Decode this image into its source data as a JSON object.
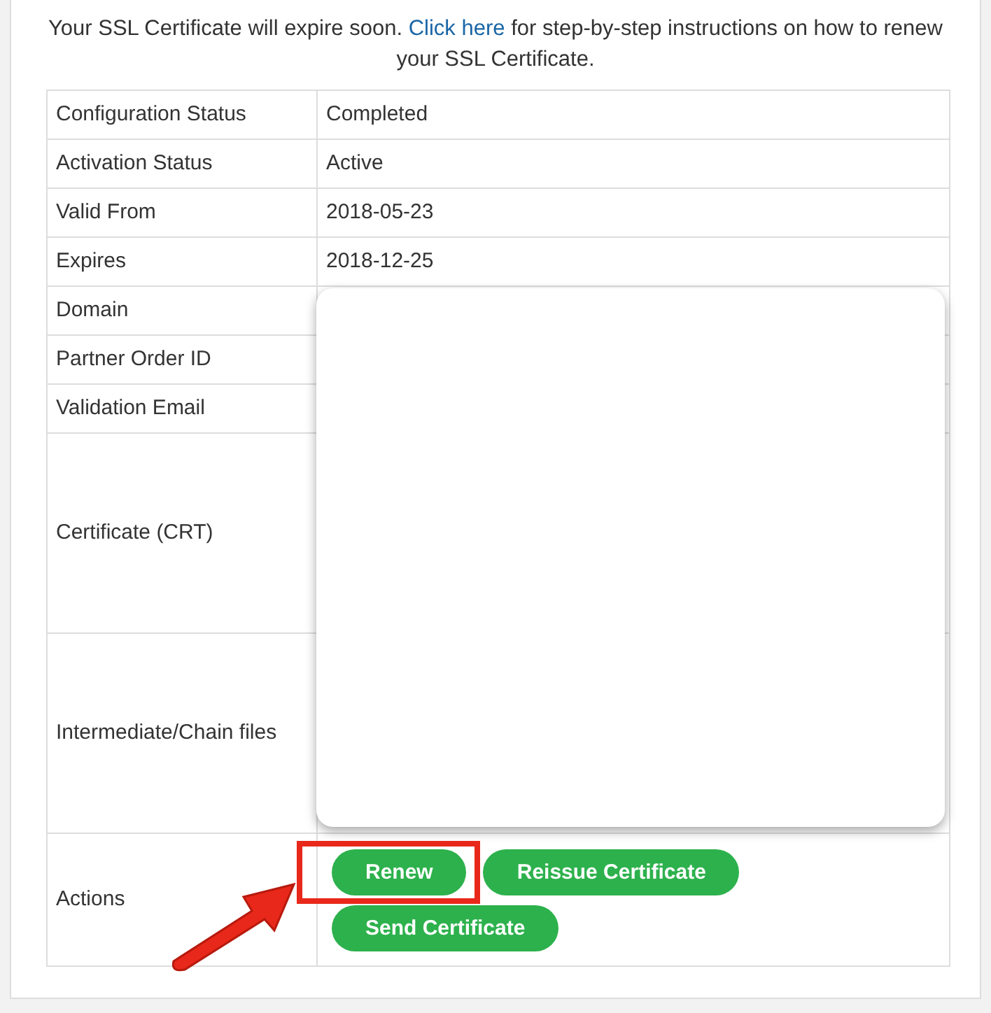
{
  "notice": {
    "text": "Your SSL Certificate will expire soon.",
    "link": "Click here",
    "after": "for step-by-step instructions on how to renew your SSL Certificate."
  },
  "details": [
    {
      "label": "Configuration Status",
      "value": "Completed",
      "kind": "normal"
    },
    {
      "label": "Activation Status",
      "value": "Active",
      "kind": "normal"
    },
    {
      "label": "Valid From",
      "value": "2018-05-23",
      "kind": "normal"
    },
    {
      "label": "Expires",
      "value": "2018-12-25",
      "kind": "normal"
    },
    {
      "label": "Domain",
      "kind": "normal"
    },
    {
      "label": "Partner Order ID",
      "kind": "normal"
    },
    {
      "label": "Validation Email",
      "kind": "normal"
    },
    {
      "label": "Certificate (CRT)",
      "kind": "tall"
    },
    {
      "label": "Intermediate/Chain files",
      "kind": "tall"
    }
  ],
  "actions": {
    "label": "Actions",
    "buttons": [
      {
        "label": "Renew",
        "annotated": true
      },
      {
        "label": "Reissue Certificate",
        "annotated": false
      },
      {
        "label": "Send Certificate",
        "annotated": false
      }
    ]
  }
}
